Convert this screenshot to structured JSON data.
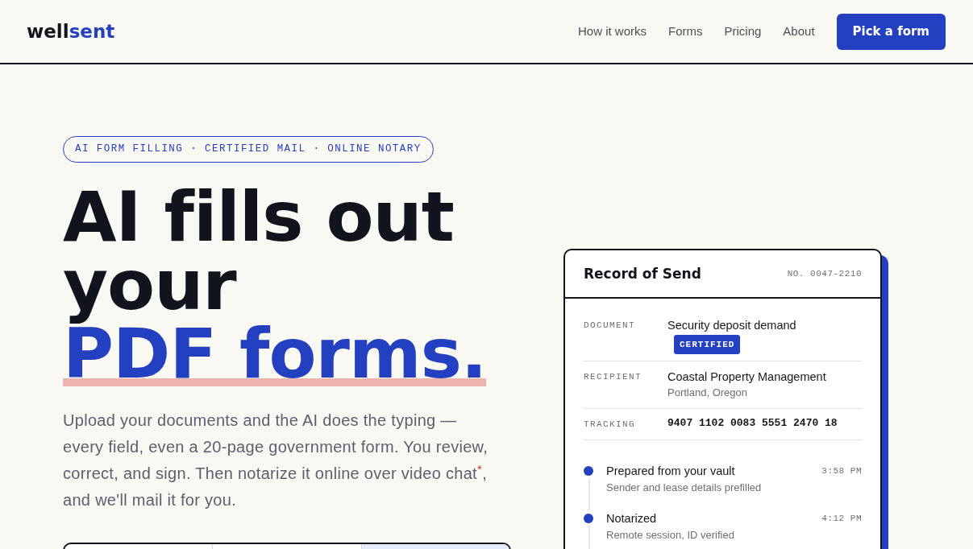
{
  "navbar": {
    "logo": {
      "text": "well",
      "accent_text": "sent"
    },
    "links": [
      "How it works",
      "Forms",
      "Pricing",
      "About"
    ],
    "cta": "Pick a form"
  },
  "hero": {
    "eyebrow": "AI FORM FILLING · CERTIFIED MAIL · ONLINE NOTARY",
    "headline": "AI fills out your",
    "headline_accent": "PDF forms.",
    "description": "Upload your documents and the AI does the typing — every field, even a 20-page government form. You review, correct, and sign. Then notarize it online over video chat$^{*}$, and we'll mail it for you.",
    "panel": {
      "segments": [
        {
          "selected": false
        },
        {
          "selected": false
        },
        {
          "selected": true
        }
      ]
    }
  },
  "record_card": {
    "title": "Record of Send",
    "number": "NO. 0047-2210",
    "fields": [
      {
        "kind": "text",
        "label": "DOCUMENT",
        "value": "Security deposit demand",
        "badge": "CERTIFIED"
      },
      {
        "kind": "text",
        "label": "RECIPIENT",
        "value": "Coastal Property Management",
        "detail": "Portland, Oregon"
      },
      {
        "kind": "code",
        "label": "TRACKING",
        "value": "9407 1102 0083 5551 2470 18"
      }
    ],
    "timeline": [
      {
        "title": "Prepared from your vault",
        "detail": "Sender and lease details prefilled",
        "time": "3:58 PM"
      },
      {
        "title": "Notarized",
        "detail": "Remote session, ID verified",
        "time": "4:12 PM"
      }
    ]
  }
}
